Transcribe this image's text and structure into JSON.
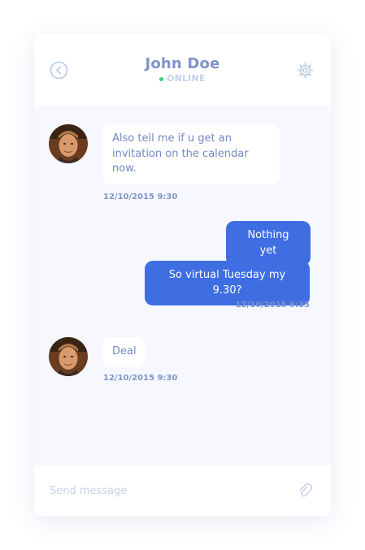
{
  "contact": {
    "name": "John Doe",
    "status": "ONLINE"
  },
  "icons": {
    "back": "back-circle-icon",
    "settings": "gear-icon",
    "attach": "paperclip-icon"
  },
  "messages": [
    {
      "direction": "incoming",
      "text": "Also tell me if u get an invitation on the calendar now."
    },
    {
      "direction": "outgoing",
      "text": "Nothing yet"
    },
    {
      "direction": "outgoing",
      "text": "So virtual Tuesday my 9.30?"
    },
    {
      "direction": "incoming",
      "text": "Deal"
    }
  ],
  "timestamps": [
    "12/10/2015 9:30",
    "12/10/2015 9:35",
    "12/10/2015 9:30"
  ],
  "composer": {
    "placeholder": "Send message"
  },
  "colors": {
    "accent": "#3e6ee1",
    "online": "#3ccf77",
    "text_primary": "#7f94c9"
  }
}
